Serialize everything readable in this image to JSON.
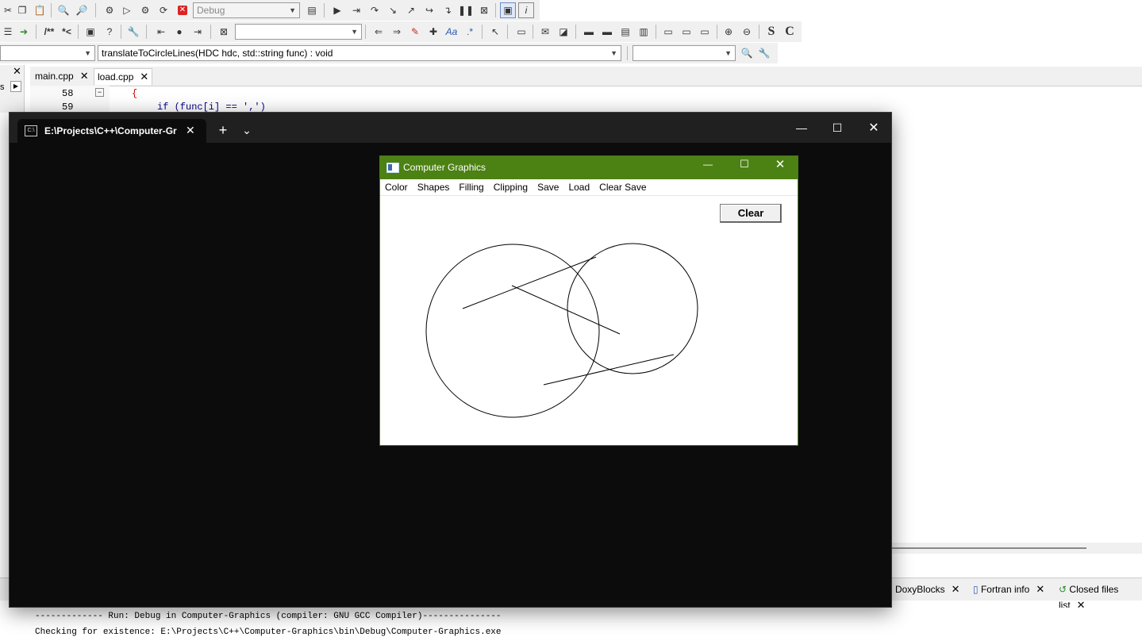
{
  "toolbar": {
    "build_target": "Debug",
    "symbol_combo": "translateToCircleLines(HDC hdc, std::string func) : void",
    "comment_block": "/**",
    "comment_line": "*<",
    "bold_s": "S",
    "bold_c": "C"
  },
  "editor": {
    "tabs": [
      {
        "label": "main.cpp"
      },
      {
        "label": "load.cpp"
      }
    ],
    "close_glyph": "✕",
    "lines": [
      {
        "num": "58",
        "text": "{"
      },
      {
        "num": "59",
        "text": "if (func[i] == ',')"
      }
    ]
  },
  "terminal": {
    "tab_title": "E:\\Projects\\C++\\Computer-Gr",
    "new_tab": "+",
    "dropdown": "⌄",
    "minimize": "—",
    "maximize": "☐",
    "close": "✕"
  },
  "app": {
    "title": "Computer Graphics",
    "menu": [
      "Color",
      "Shapes",
      "Filling",
      "Clipping",
      "Save",
      "Load",
      "Clear Save"
    ],
    "clear_button": "Clear",
    "controls": {
      "minimize": "—",
      "maximize": "☐",
      "close": "✕"
    }
  },
  "bottom_tabs": [
    {
      "label": "DoxyBlocks"
    },
    {
      "label": "Fortran info"
    },
    {
      "label": "Closed files list"
    }
  ],
  "log": [
    "------------- Run: Debug in Computer-Graphics (compiler: GNU GCC Compiler)---------------",
    "Checking for existence: E:\\Projects\\C++\\Computer-Graphics\\bin\\Debug\\Computer-Graphics.exe"
  ],
  "colors": {
    "app_titlebar": "#4c8113",
    "terminal_bg": "#0c0c0c",
    "terminal_titlebar": "#202020",
    "keyword": "#00008b",
    "string": "#0000ff"
  }
}
